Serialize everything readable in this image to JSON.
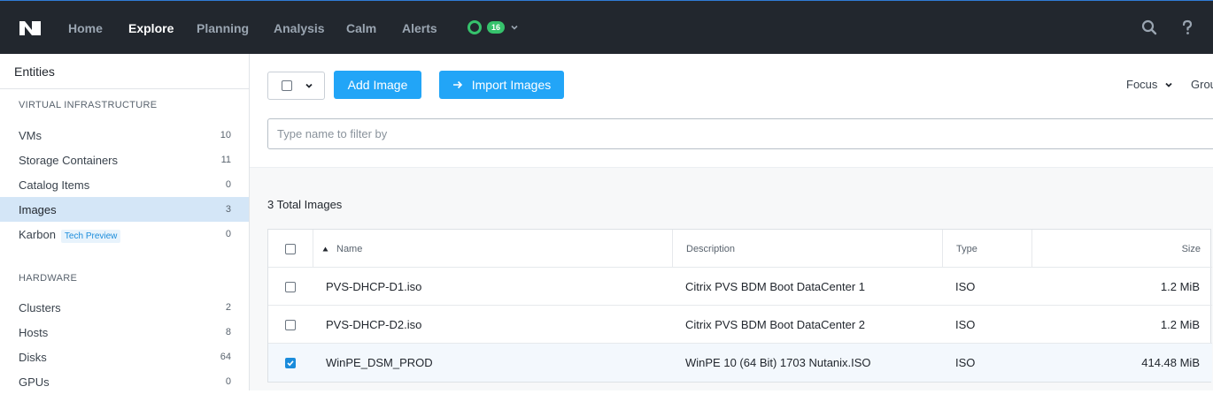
{
  "nav": {
    "items": [
      {
        "label": "Home",
        "active": false
      },
      {
        "label": "Explore",
        "active": true
      },
      {
        "label": "Planning",
        "active": false
      },
      {
        "label": "Analysis",
        "active": false
      },
      {
        "label": "Calm",
        "active": false
      },
      {
        "label": "Alerts",
        "active": false
      }
    ],
    "alert_count": "16",
    "icons": [
      "nutanix-logo",
      "status-ring-icon",
      "chevron-down-icon",
      "search-icon",
      "help-icon"
    ]
  },
  "sidebar": {
    "title": "Entities",
    "sections": [
      {
        "heading": "VIRTUAL INFRASTRUCTURE",
        "items": [
          {
            "label": "VMs",
            "count": "10"
          },
          {
            "label": "Storage Containers",
            "count": "11"
          },
          {
            "label": "Catalog Items",
            "count": "0"
          },
          {
            "label": "Images",
            "count": "3",
            "active": true
          },
          {
            "label": "Karbon",
            "tag": "Tech Preview",
            "count": "0"
          }
        ]
      },
      {
        "heading": "HARDWARE",
        "items": [
          {
            "label": "Clusters",
            "count": "2"
          },
          {
            "label": "Hosts",
            "count": "8"
          },
          {
            "label": "Disks",
            "count": "64"
          },
          {
            "label": "GPUs",
            "count": "0"
          }
        ]
      }
    ]
  },
  "toolbar": {
    "add_image": "Add Image",
    "import_images": "Import Images",
    "focus": "Focus",
    "group": "Grou",
    "filter_placeholder": "Type name to filter by"
  },
  "table": {
    "total_label": "3 Total Images",
    "columns": [
      "Name",
      "Description",
      "Type",
      "Size"
    ],
    "rows": [
      {
        "name": "PVS-DHCP-D1.iso",
        "description": "Citrix PVS BDM Boot DataCenter 1",
        "type": "ISO",
        "size": "1.2 MiB",
        "checked": false
      },
      {
        "name": "PVS-DHCP-D2.iso",
        "description": "Citrix PVS BDM Boot DataCenter 2",
        "type": "ISO",
        "size": "1.2 MiB",
        "checked": false
      },
      {
        "name": "WinPE_DSM_PROD",
        "description": "WinPE 10 (64 Bit) 1703 Nutanix.ISO",
        "type": "ISO",
        "size": "414.48 MiB",
        "checked": true
      }
    ]
  },
  "colors": {
    "topbar": "#22272e",
    "accent": "#22a5f7",
    "status_green": "#36c26c",
    "active_row": "#d4e6f7"
  }
}
